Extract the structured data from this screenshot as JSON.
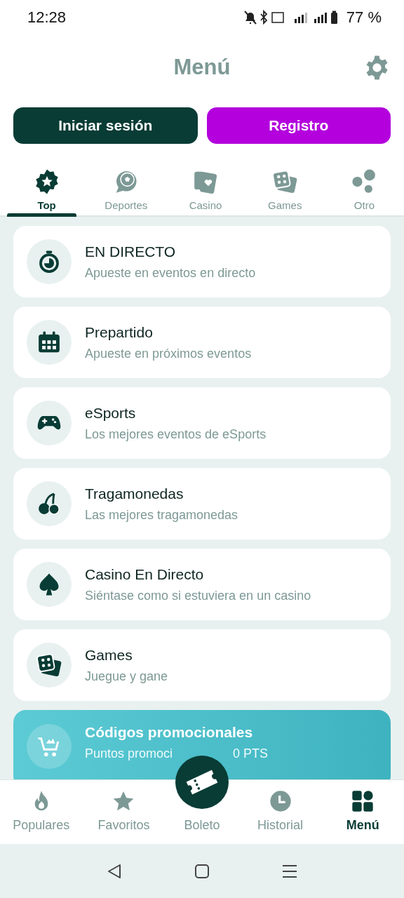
{
  "status_bar": {
    "time": "12:28",
    "battery": "77 %"
  },
  "header": {
    "title": "Menú"
  },
  "auth_buttons": [
    {
      "label": "Iniciar sesión",
      "kind": "login"
    },
    {
      "label": "Registro",
      "kind": "register"
    }
  ],
  "tabs": [
    {
      "label": "Top",
      "kind": "badge",
      "selected": true
    },
    {
      "label": "Deportes",
      "kind": "ball",
      "selected": false
    },
    {
      "label": "Casino",
      "kind": "cards",
      "selected": false
    },
    {
      "label": "Games",
      "kind": "dice",
      "selected": false
    },
    {
      "label": "Otro",
      "kind": "dots",
      "selected": false
    }
  ],
  "menu_items": [
    {
      "title": "EN DIRECTO",
      "subtitle": "Apueste en eventos en directo",
      "kind": "stopwatch"
    },
    {
      "title": "Prepartido",
      "subtitle": "Apueste en próximos eventos",
      "kind": "calendar"
    },
    {
      "title": "eSports",
      "subtitle": "Los mejores eventos de eSports",
      "kind": "gamepad"
    },
    {
      "title": "Tragamonedas",
      "subtitle": "Las mejores tragamonedas",
      "kind": "cherry"
    },
    {
      "title": "Casino En Directo",
      "subtitle": "Siéntase como si estuviera en un casino",
      "kind": "spade"
    },
    {
      "title": "Games",
      "subtitle": "Juegue y gane",
      "kind": "dice"
    }
  ],
  "promo": {
    "title": "Códigos promocionales",
    "subtitle_start": "Puntos promoci",
    "subtitle_end": "0 PTS"
  },
  "bottom_nav": [
    {
      "label": "Populares",
      "kind": "flame",
      "selected": false
    },
    {
      "label": "Favoritos",
      "kind": "star",
      "selected": false
    },
    {
      "label": "Boleto",
      "kind": "ticket",
      "selected": false
    },
    {
      "label": "Historial",
      "kind": "clock",
      "selected": false
    },
    {
      "label": "Menú",
      "kind": "grid",
      "selected": true
    }
  ]
}
